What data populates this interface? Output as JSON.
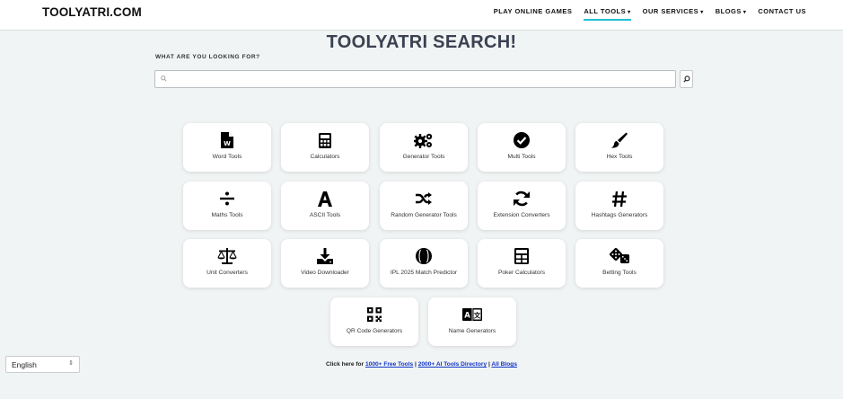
{
  "header": {
    "logo": "TOOLYATRI.COM",
    "nav": [
      {
        "label": "PLAY ONLINE GAMES",
        "caret": false,
        "active": false
      },
      {
        "label": "ALL TOOLS",
        "caret": true,
        "active": true
      },
      {
        "label": "OUR SERVICES",
        "caret": true,
        "active": false
      },
      {
        "label": "BLOGS",
        "caret": true,
        "active": false
      },
      {
        "label": "CONTACT US",
        "caret": false,
        "active": false
      }
    ],
    "caret_glyph": "▾"
  },
  "search": {
    "title": "TOOLYATRI SEARCH!",
    "label": "WHAT ARE YOU LOOKING FOR?",
    "value": "",
    "placeholder": ""
  },
  "tools": [
    {
      "label": "Word Tools",
      "icon": "word-file-icon"
    },
    {
      "label": "Calculators",
      "icon": "calculator-icon"
    },
    {
      "label": "Generator Tools",
      "icon": "gears-icon"
    },
    {
      "label": "Multi Tools",
      "icon": "check-circle-icon"
    },
    {
      "label": "Hex Tools",
      "icon": "paintbrush-icon"
    },
    {
      "label": "Maths Tools",
      "icon": "divide-icon"
    },
    {
      "label": "ASCII Tools",
      "icon": "letter-a-icon"
    },
    {
      "label": "Random Generator Tools",
      "icon": "shuffle-icon"
    },
    {
      "label": "Extension Converters",
      "icon": "sync-icon"
    },
    {
      "label": "Hashtags Generators",
      "icon": "hashtag-icon"
    },
    {
      "label": "Unit Converters",
      "icon": "scale-icon"
    },
    {
      "label": "Video Downloader",
      "icon": "download-icon"
    },
    {
      "label": "IPL 2025 Match Predictor",
      "icon": "cricket-ball-icon"
    },
    {
      "label": "Poker Calculators",
      "icon": "calculator-icon"
    },
    {
      "label": "Betting Tools",
      "icon": "dice-icon"
    },
    {
      "label": "QR Code Generators",
      "icon": "qrcode-icon"
    },
    {
      "label": "Name Generators",
      "icon": "language-icon"
    }
  ],
  "language": {
    "value": "English"
  },
  "footer": {
    "prefix": "Click here for ",
    "link1": "1000+ Free Tools",
    "sep1": " | ",
    "link2": "2000+ AI Tools Directory",
    "sep2": " | ",
    "link3": "All Blogs"
  }
}
